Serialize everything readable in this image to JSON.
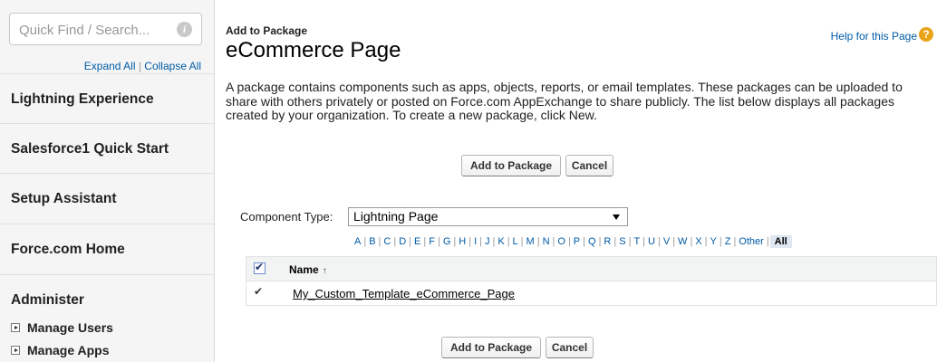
{
  "sidebar": {
    "search_placeholder": "Quick Find / Search...",
    "info_icon": "i",
    "expand_all": "Expand All",
    "separator": " | ",
    "collapse_all": "Collapse All",
    "sections": {
      "lightning": "Lightning Experience",
      "sf1": "Salesforce1 Quick Start",
      "setup": "Setup Assistant",
      "force_home": "Force.com Home",
      "administer": "Administer"
    },
    "sub_items": {
      "manage_users": "Manage Users",
      "manage_apps": "Manage Apps"
    }
  },
  "header": {
    "breadcrumb": "Add to Package",
    "title": "eCommerce Page",
    "help_link": "Help for this Page",
    "help_icon": "?"
  },
  "description": "A package contains components such as apps, objects, reports, or email templates. These packages can be uploaded to share with others privately or posted on Force.com AppExchange to share publicly. The list below displays all packages created by your organization. To create a new package, click New.",
  "buttons": {
    "add_to_package": "Add to Package",
    "cancel": "Cancel"
  },
  "filter": {
    "label": "Component Type:",
    "selected": "Lightning Page"
  },
  "alphabet": [
    "A",
    "B",
    "C",
    "D",
    "E",
    "F",
    "G",
    "H",
    "I",
    "J",
    "K",
    "L",
    "M",
    "N",
    "O",
    "P",
    "Q",
    "R",
    "S",
    "T",
    "U",
    "V",
    "W",
    "X",
    "Y",
    "Z",
    "Other",
    "All"
  ],
  "table": {
    "column_name": "Name",
    "sort_indicator": "↑",
    "rows": [
      {
        "name": "My_Custom_Template_eCommerce_Page",
        "checked": true
      }
    ]
  },
  "colors": {
    "link": "#015ba7",
    "help_icon": "#e8a317",
    "sidebar_bg": "#f5f5f5"
  }
}
